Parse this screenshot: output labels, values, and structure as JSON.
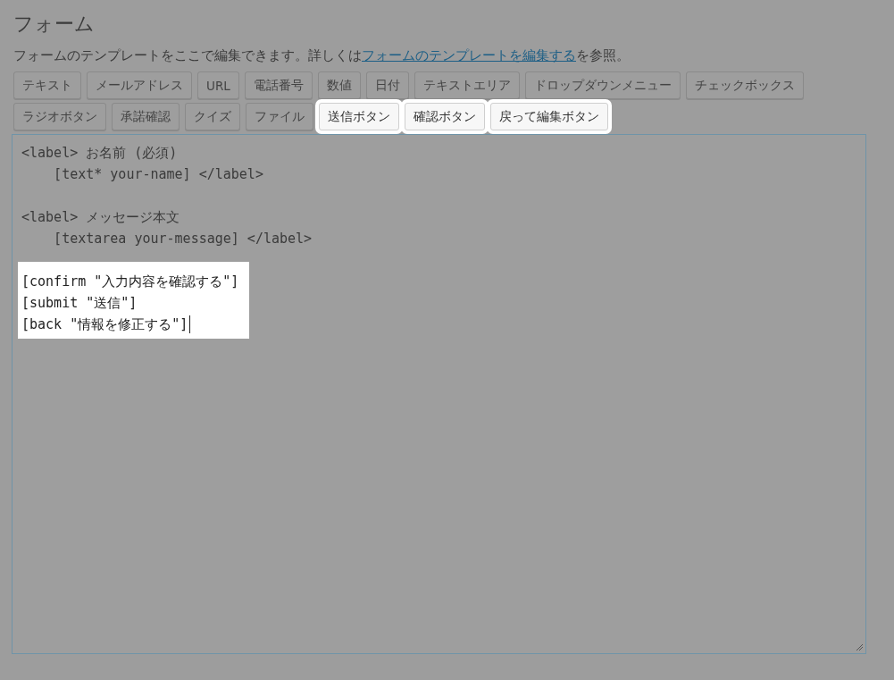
{
  "title": "フォーム",
  "description": {
    "text": "フォームのテンプレートをここで編集できます。詳しくは",
    "link": "フォームのテンプレートを編集する",
    "suffix": "を参照。"
  },
  "tag_buttons": [
    [
      {
        "label": "テキスト",
        "highlighted": false
      },
      {
        "label": "メールアドレス",
        "highlighted": false
      },
      {
        "label": "URL",
        "highlighted": false
      },
      {
        "label": "電話番号",
        "highlighted": false
      },
      {
        "label": "数値",
        "highlighted": false
      },
      {
        "label": "日付",
        "highlighted": false
      },
      {
        "label": "テキストエリア",
        "highlighted": false
      },
      {
        "label": "ドロップダウンメニュー",
        "highlighted": false
      },
      {
        "label": "チェックボックス",
        "highlighted": false
      }
    ],
    [
      {
        "label": "ラジオボタン",
        "highlighted": false
      },
      {
        "label": "承諾確認",
        "highlighted": false
      },
      {
        "label": "クイズ",
        "highlighted": false
      },
      {
        "label": "ファイル",
        "highlighted": false
      },
      {
        "label": "送信ボタン",
        "highlighted": true
      },
      {
        "label": "確認ボタン",
        "highlighted": true
      },
      {
        "label": "戻って編集ボタン",
        "highlighted": true
      }
    ]
  ],
  "editor": {
    "blocks": [
      {
        "highlighted": false,
        "lines": [
          "<label> お名前 (必須)",
          "    [text* your-name] </label>"
        ]
      },
      {
        "highlighted": false,
        "lines": [
          "<label> メッセージ本文",
          "    [textarea your-message] </label>"
        ]
      },
      {
        "highlighted": true,
        "lines": [
          "[confirm \"入力内容を確認する\"]",
          "[submit \"送信\"]",
          "[back \"情報を修正する\"]"
        ]
      }
    ]
  }
}
